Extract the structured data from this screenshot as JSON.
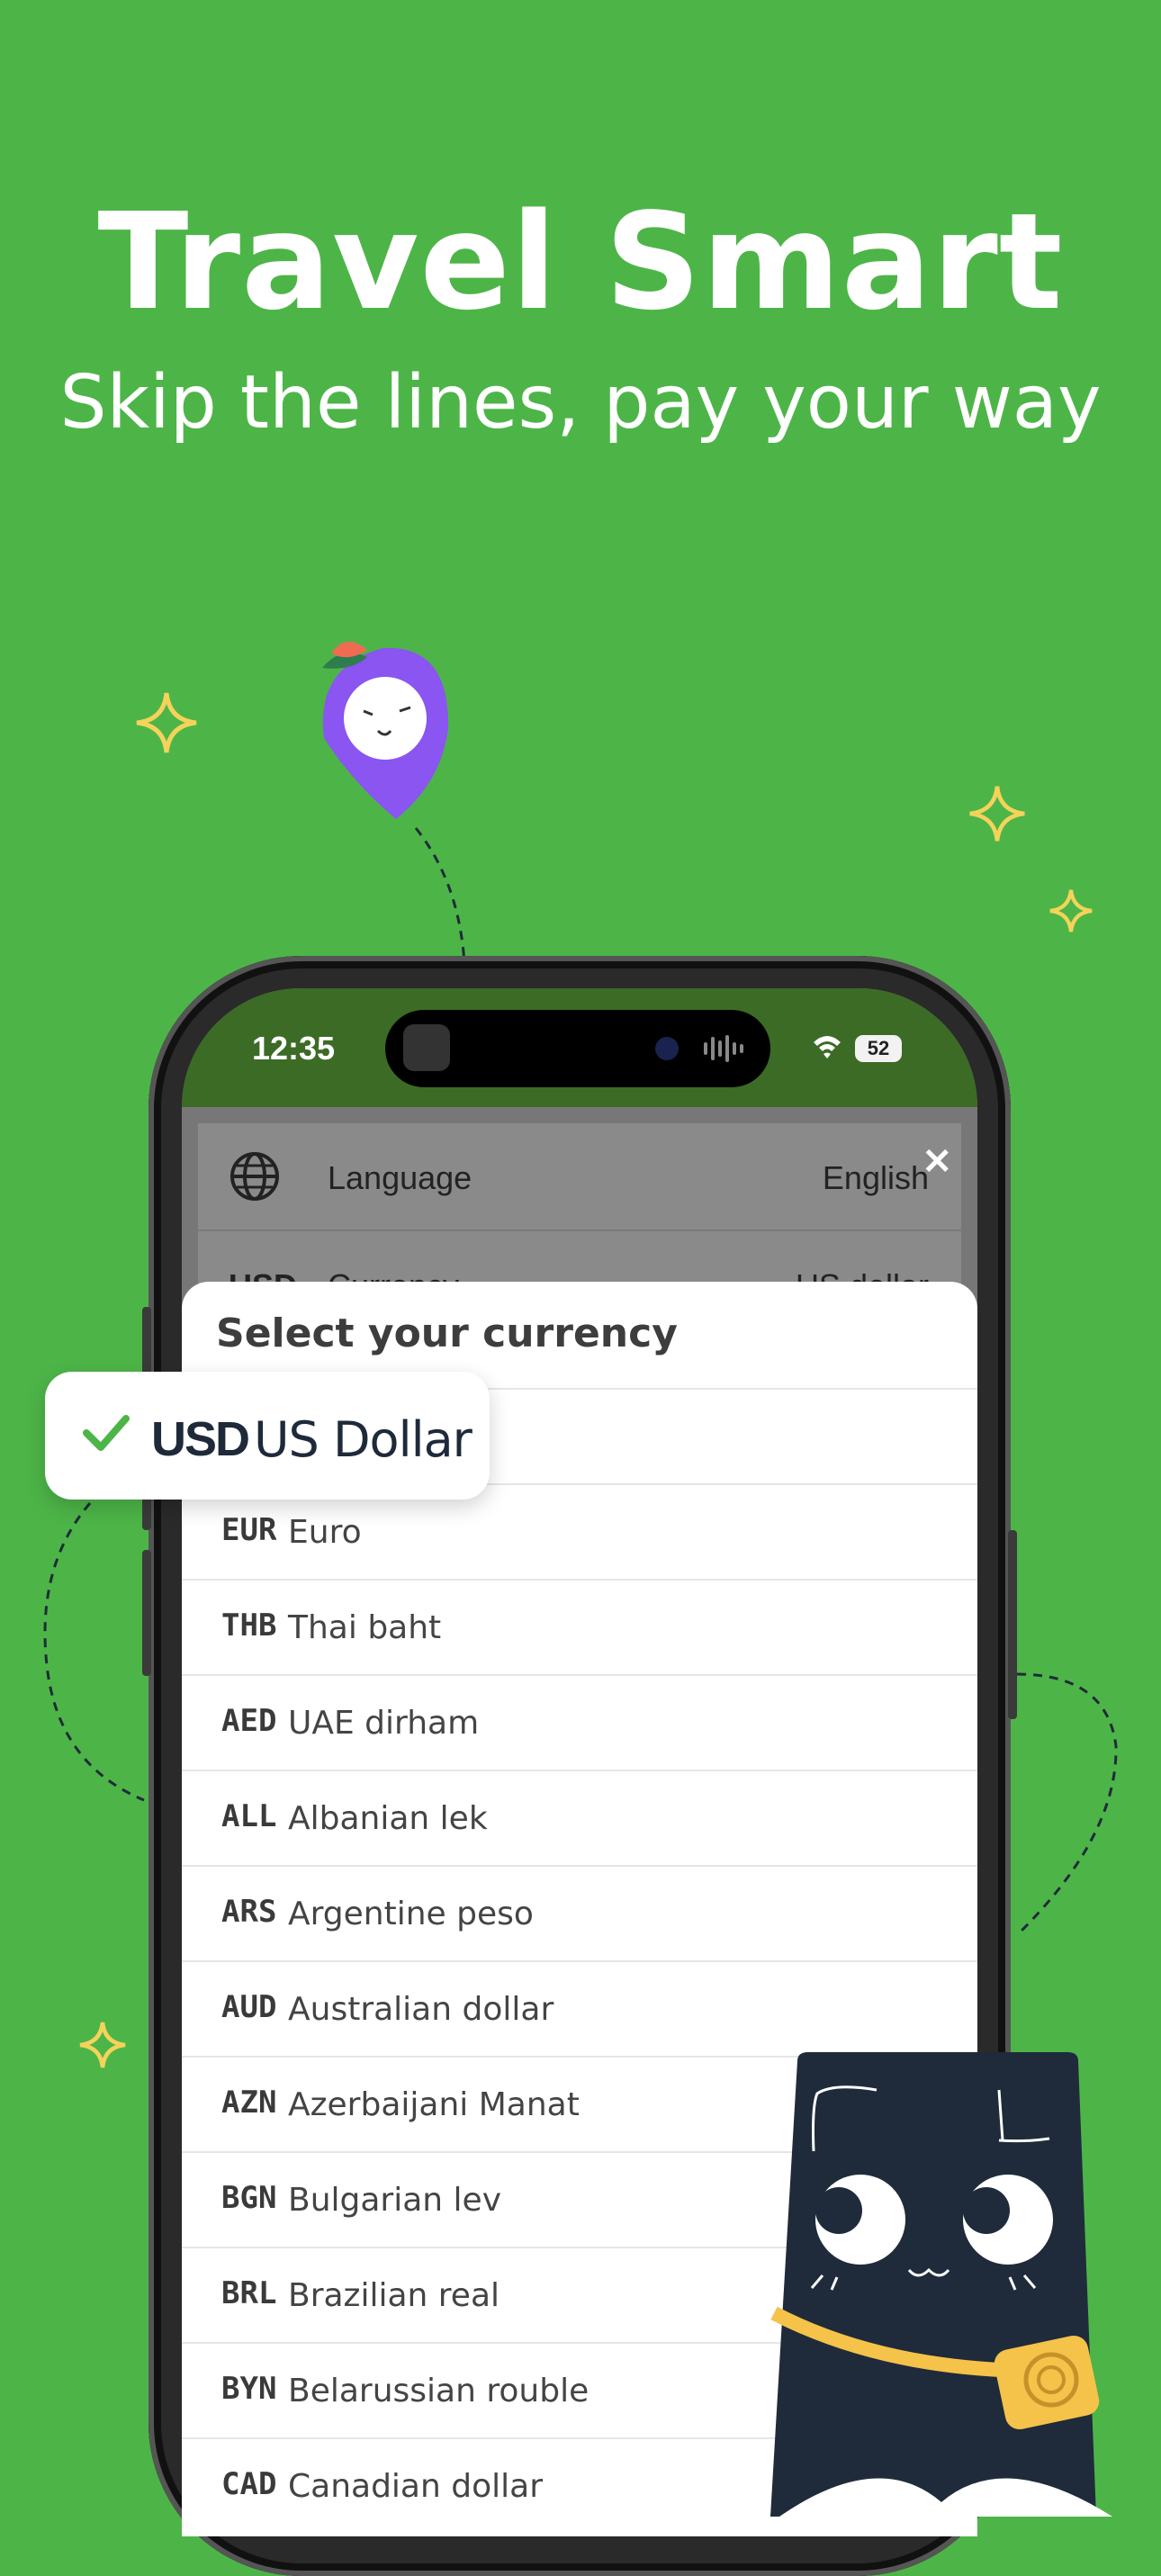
{
  "hero": {
    "title": "Travel Smart",
    "subtitle": "Skip the lines, pay your way"
  },
  "status_bar": {
    "time": "12:35",
    "battery": "52"
  },
  "settings": {
    "language_label": "Language",
    "language_value": "English",
    "currency_code": "USD",
    "currency_label": "Currency",
    "currency_value": "US dollar"
  },
  "sheet": {
    "title": "Select your currency",
    "selected": {
      "code": "USD",
      "name": "US Dollar"
    },
    "currencies": [
      {
        "code": "EUR",
        "name": "Euro"
      },
      {
        "code": "THB",
        "name": "Thai baht"
      },
      {
        "code": "AED",
        "name": "UAE dirham"
      },
      {
        "code": "ALL",
        "name": "Albanian lek"
      },
      {
        "code": "ARS",
        "name": "Argentine peso"
      },
      {
        "code": "AUD",
        "name": "Australian dollar"
      },
      {
        "code": "AZN",
        "name": "Azerbaijani Manat"
      },
      {
        "code": "BGN",
        "name": "Bulgarian lev"
      },
      {
        "code": "BRL",
        "name": "Brazilian real"
      },
      {
        "code": "BYN",
        "name": "Belarussian rouble"
      },
      {
        "code": "CAD",
        "name": "Canadian dollar"
      }
    ]
  },
  "colors": {
    "background": "#4db548",
    "status_bar": "#3c6b25",
    "check": "#4db548",
    "sparkle": "#f5d35a",
    "mascot_purple": "#8a55f0",
    "mascot_dark": "#1f2b3a"
  }
}
